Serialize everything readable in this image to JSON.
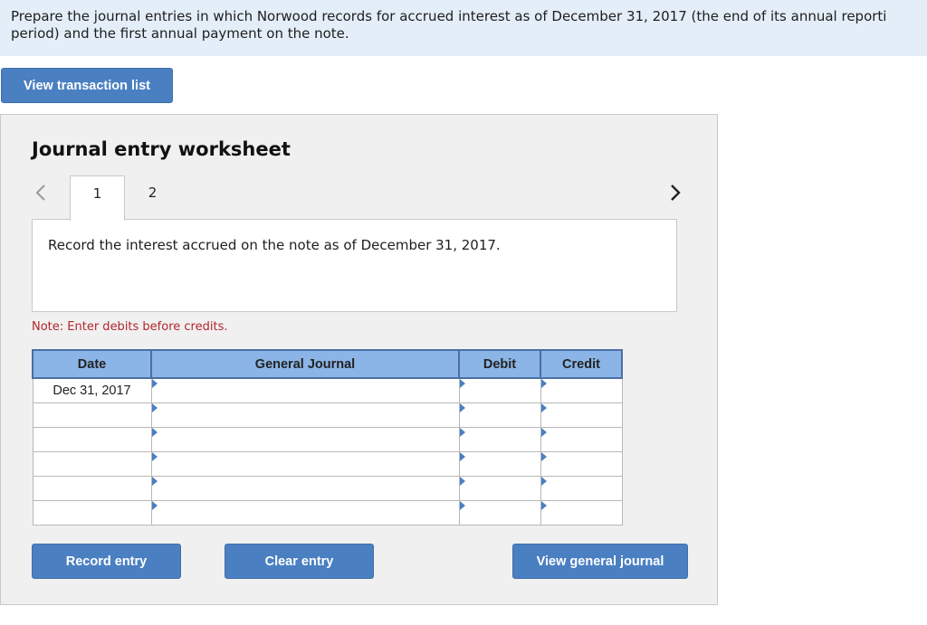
{
  "question": {
    "line1": "Prepare the journal entries in which Norwood records for accrued interest as of December 31, 2017 (the end of its annual reporti",
    "line2": "period) and the first annual payment on the note."
  },
  "toolbar": {
    "view_transaction_list": "View transaction list"
  },
  "worksheet": {
    "title": "Journal entry worksheet",
    "tabs": [
      {
        "label": "1",
        "active": true
      },
      {
        "label": "2",
        "active": false
      }
    ],
    "instruction": "Record the interest accrued on the note as of December 31, 2017.",
    "note": "Note: Enter debits before credits."
  },
  "table": {
    "headers": {
      "date": "Date",
      "general_journal": "General Journal",
      "debit": "Debit",
      "credit": "Credit"
    },
    "rows": [
      {
        "date": "Dec 31, 2017",
        "account": "",
        "debit": "",
        "credit": ""
      },
      {
        "date": "",
        "account": "",
        "debit": "",
        "credit": ""
      },
      {
        "date": "",
        "account": "",
        "debit": "",
        "credit": ""
      },
      {
        "date": "",
        "account": "",
        "debit": "",
        "credit": ""
      },
      {
        "date": "",
        "account": "",
        "debit": "",
        "credit": ""
      },
      {
        "date": "",
        "account": "",
        "debit": "",
        "credit": ""
      }
    ]
  },
  "buttons": {
    "record_entry": "Record entry",
    "clear_entry": "Clear entry",
    "view_general_journal": "View general journal"
  },
  "colors": {
    "banner_bg": "#e3eef9",
    "button_bg": "#4a80c2",
    "header_bg": "#8bb5e6",
    "note_text": "#b3262e"
  }
}
